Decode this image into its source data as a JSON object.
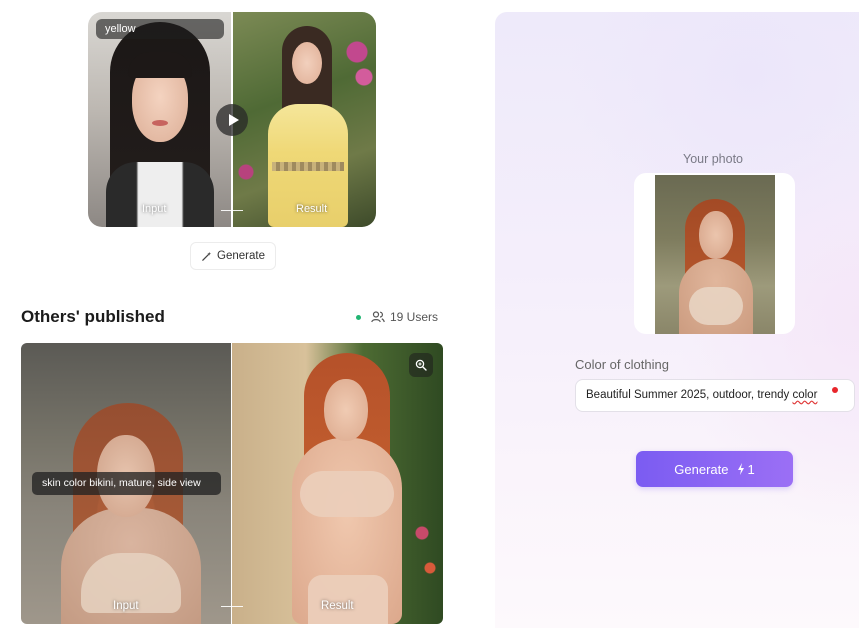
{
  "example": {
    "style_tag": "yellow",
    "input_label": "Input",
    "result_label": "Result",
    "generate_label": "Generate"
  },
  "published": {
    "title": "Others' published",
    "users_count": "19 Users",
    "prompt_tag": "skin color bikini, mature, side view",
    "input_label": "Input",
    "result_label": "Result"
  },
  "panel": {
    "your_photo_label": "Your photo",
    "field_label": "Color of clothing",
    "prompt_value_before": "Beautiful Summer 2025, outdoor, trendy ",
    "prompt_value_flagged": "color",
    "generate_label": "Generate",
    "generate_cost": "1"
  },
  "colors": {
    "accent_purple": "#8466f3",
    "online_green": "#22b573",
    "spellcheck_red": "#e03a3a"
  },
  "icons": {
    "play": "play-icon",
    "magic_wand": "magic-wand-icon",
    "users": "users-icon",
    "zoom": "zoom-in-icon",
    "bolt": "lightning-icon"
  }
}
